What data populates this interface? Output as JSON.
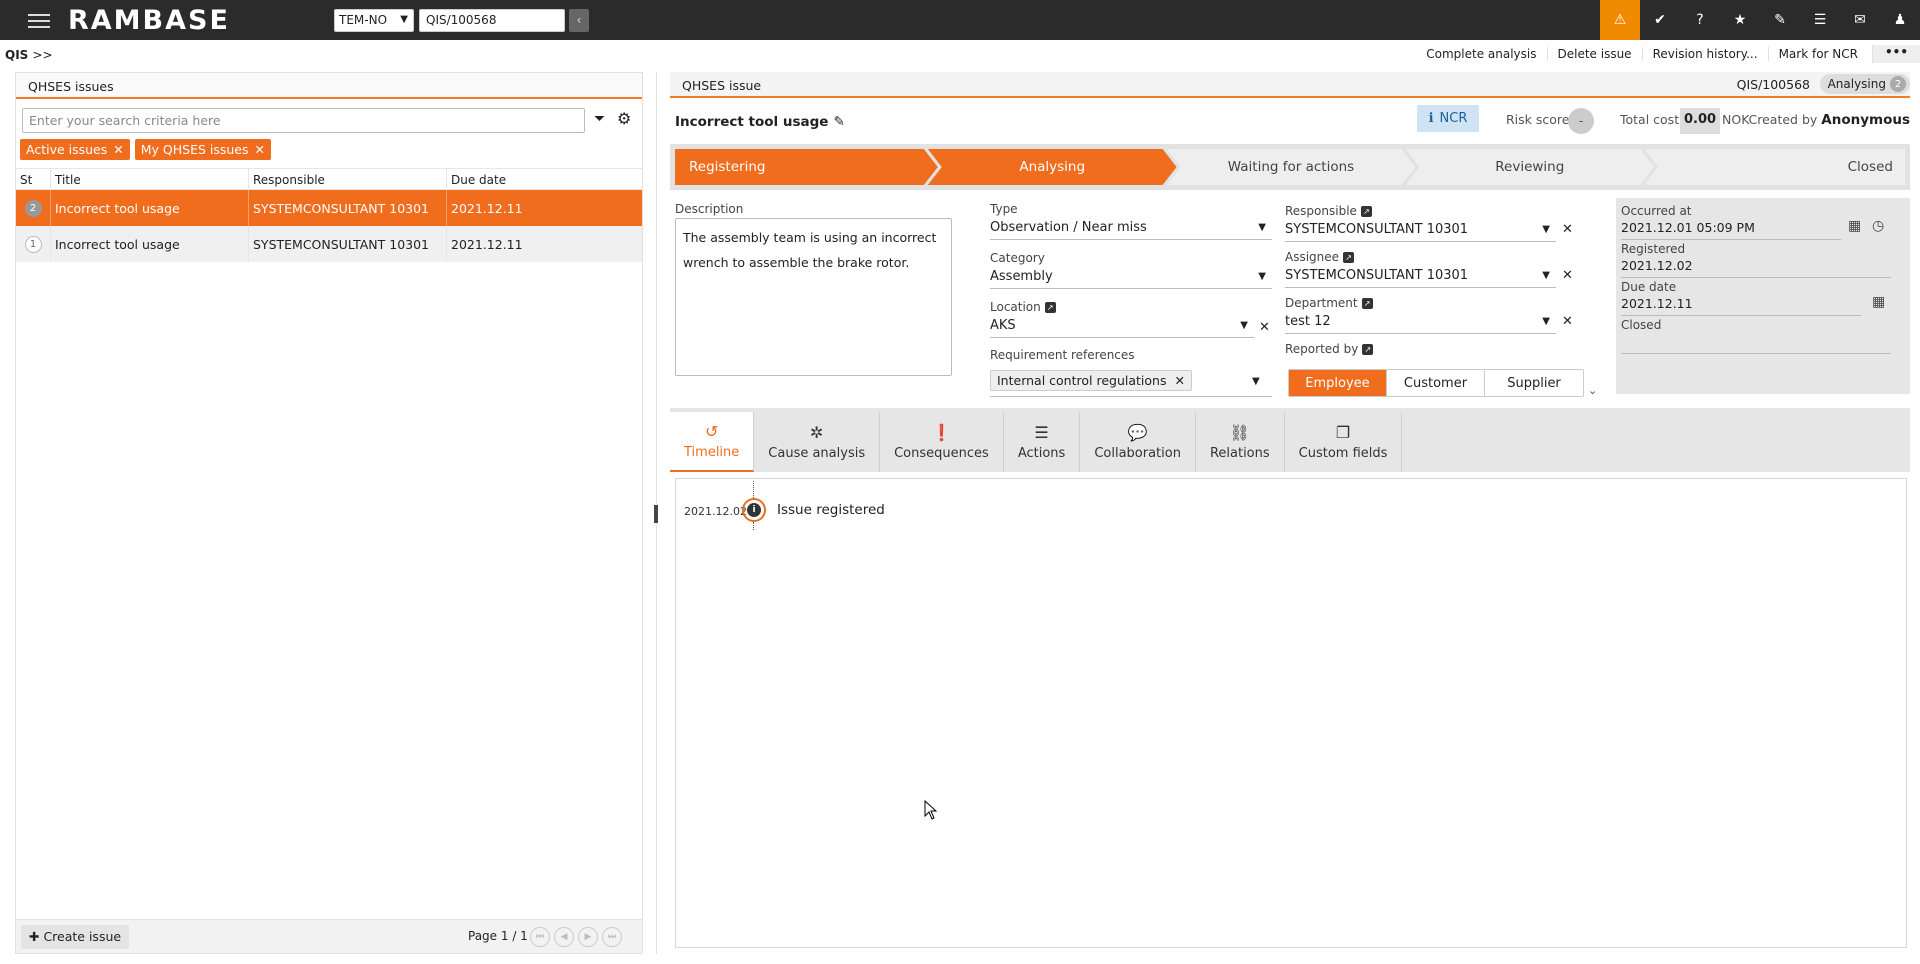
{
  "app": {
    "logo": "RAMBASE",
    "company": "TEM-NO",
    "search_value": "QIS/100568"
  },
  "topbar_icons": [
    "warning-icon",
    "check-badge-icon",
    "help-icon",
    "star-icon",
    "paperclip-icon",
    "list-icon",
    "mail-icon",
    "user-icon"
  ],
  "breadcrumb": {
    "module": "QIS",
    "arrows": ">>"
  },
  "actions": [
    "Complete analysis",
    "Delete issue",
    "Revision history...",
    "Mark for NCR",
    "•••"
  ],
  "left": {
    "title": "QHSES issues",
    "search_placeholder": "Enter your search criteria here",
    "chips": [
      "Active issues",
      "My QHSES issues"
    ],
    "columns": [
      "St",
      "Title",
      "Responsible",
      "Due date"
    ],
    "rows": [
      {
        "st": "2",
        "title": "Incorrect tool usage",
        "responsible": "SYSTEMCONSULTANT 10301",
        "due": "2021.12.11"
      },
      {
        "st": "1",
        "title": "Incorrect tool usage",
        "responsible": "SYSTEMCONSULTANT 10301",
        "due": "2021.12.11"
      }
    ],
    "create_label": "Create issue",
    "pager": "Page 1 / 1"
  },
  "right": {
    "title": "QHSES issue",
    "id": "QIS/100568",
    "status": "Analysing",
    "status_count": "2",
    "issue_title": "Incorrect tool usage",
    "ncr": "NCR",
    "risk_label": "Risk score",
    "risk_value": "-",
    "cost_label": "Total cost",
    "cost_value": "0.00",
    "currency": "NOK",
    "created_label": "Created by",
    "created_by": "Anonymous",
    "steps": [
      "Registering",
      "Analysing",
      "Waiting for actions",
      "Reviewing",
      "Closed"
    ],
    "form": {
      "description_label": "Description",
      "description": "The assembly team is using an incorrect wrench to assemble the brake rotor.",
      "type_label": "Type",
      "type": "Observation / Near miss",
      "category_label": "Category",
      "category": "Assembly",
      "location_label": "Location",
      "location": "AKS",
      "req_label": "Requirement references",
      "req_chip": "Internal control regulations",
      "responsible_label": "Responsible",
      "responsible": "SYSTEMCONSULTANT 10301",
      "assignee_label": "Assignee",
      "assignee": "SYSTEMCONSULTANT 10301",
      "department_label": "Department",
      "department": "test 12",
      "reported_label": "Reported by",
      "reported_options": [
        "Employee",
        "Customer",
        "Supplier"
      ],
      "occurred_label": "Occurred at",
      "occurred": "2021.12.01 05:09 PM",
      "registered_label": "Registered",
      "registered": "2021.12.02",
      "due_label": "Due date",
      "due": "2021.12.11",
      "closed_label": "Closed",
      "closed": ""
    },
    "tabs": [
      "Timeline",
      "Cause analysis",
      "Consequences",
      "Actions",
      "Collaboration",
      "Relations",
      "Custom fields"
    ],
    "timeline": [
      {
        "date": "2021.12.02",
        "text": "Issue registered"
      }
    ]
  },
  "colors": {
    "accent": "#f06d1e",
    "topbar": "#2b2b2b",
    "alert": "#f08a00",
    "ncr_bg": "#cfe3f5"
  }
}
